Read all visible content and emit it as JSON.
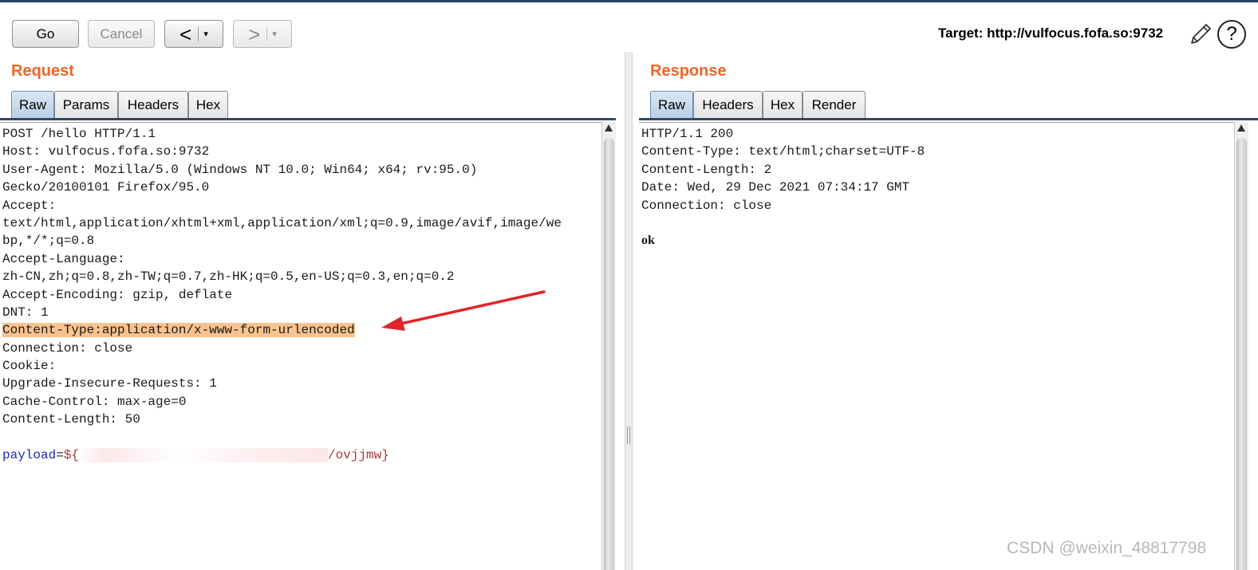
{
  "toolbar": {
    "go_label": "Go",
    "cancel_label": "Cancel",
    "back_glyph": "<",
    "forward_glyph": ">",
    "dropdown_glyph": "▾",
    "target_text": "Target: http://vulfocus.fofa.so:9732",
    "edit_icon": "pencil-icon",
    "help_glyph": "?"
  },
  "request": {
    "title": "Request",
    "tabs": [
      "Raw",
      "Params",
      "Headers",
      "Hex"
    ],
    "active_tab": "Raw",
    "lines": [
      "POST /hello HTTP/1.1",
      "Host: vulfocus.fofa.so:9732",
      "User-Agent: Mozilla/5.0 (Windows NT 10.0; Win64; x64; rv:95.0)",
      "Gecko/20100101 Firefox/95.0",
      "Accept:",
      "text/html,application/xhtml+xml,application/xml;q=0.9,image/avif,image/we",
      "bp,*/*;q=0.8",
      "Accept-Language:",
      "zh-CN,zh;q=0.8,zh-TW;q=0.7,zh-HK;q=0.5,en-US;q=0.3,en;q=0.2",
      "Accept-Encoding: gzip, deflate",
      "DNT: 1",
      "Content-Type:application/x-www-form-urlencoded",
      "Connection: close",
      "Cookie:",
      "Upgrade-Insecure-Requests: 1",
      "Cache-Control: max-age=0",
      "Content-Length: 50",
      ""
    ],
    "payload": {
      "key": "payload",
      "eq": "=",
      "prefix": "${",
      "suffix": "/ovjjmw}"
    }
  },
  "response": {
    "title": "Response",
    "tabs": [
      "Raw",
      "Headers",
      "Hex",
      "Render"
    ],
    "active_tab": "Raw",
    "lines": [
      "HTTP/1.1 200",
      "Content-Type: text/html;charset=UTF-8",
      "Content-Length: 2",
      "Date: Wed, 29 Dec 2021 07:34:17 GMT",
      "Connection: close",
      ""
    ],
    "body": "ok"
  },
  "watermark": "CSDN @weixin_48817798",
  "colors": {
    "title_orange": "#f26424",
    "highlight": "#f9c28e",
    "annotation_arrow": "#e0252b",
    "payload_key": "#1c2ea8",
    "payload_value": "#b2342d"
  }
}
